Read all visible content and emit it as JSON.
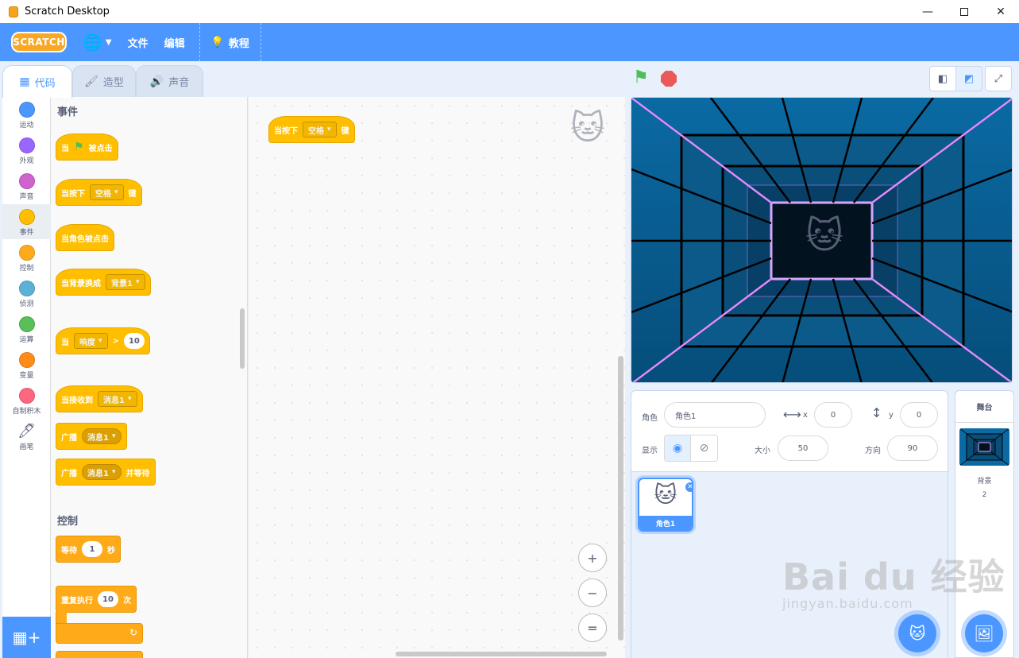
{
  "window": {
    "title": "Scratch Desktop",
    "min": "—",
    "close": "✕"
  },
  "menubar": {
    "logo": "SCRATCH",
    "file": "文件",
    "edit": "编辑",
    "tutorials": "教程"
  },
  "tabs": {
    "code": "代码",
    "costumes": "造型",
    "sounds": "声音"
  },
  "categories": [
    {
      "label": "运动",
      "color": "#4c97ff"
    },
    {
      "label": "外观",
      "color": "#9966ff"
    },
    {
      "label": "声音",
      "color": "#cf63cf"
    },
    {
      "label": "事件",
      "color": "#ffbf00"
    },
    {
      "label": "控制",
      "color": "#ffab19"
    },
    {
      "label": "侦测",
      "color": "#5cb1d6"
    },
    {
      "label": "运算",
      "color": "#59c059"
    },
    {
      "label": "变量",
      "color": "#ff8c1a"
    },
    {
      "label": "自制积木",
      "color": "#ff6680"
    },
    {
      "label": "画笔",
      "color": "#0fbd8c"
    }
  ],
  "palette": {
    "events_heading": "事件",
    "when_flag_pre": "当",
    "when_flag_post": "被点击",
    "when_key_pre": "当按下",
    "when_key_value": "空格",
    "when_key_post": "键",
    "when_sprite_clicked": "当角色被点击",
    "when_backdrop_pre": "当背景换成",
    "when_backdrop_value": "背景1",
    "when_loudness_pre": "当",
    "when_loudness_value": "响度",
    "when_loudness_op": ">",
    "when_loudness_num": "10",
    "when_receive_pre": "当接收到",
    "when_receive_value": "消息1",
    "broadcast_pre": "广播",
    "broadcast_value": "消息1",
    "broadcast_wait_pre": "广播",
    "broadcast_wait_value": "消息1",
    "broadcast_wait_post": "并等待",
    "control_heading": "控制",
    "wait_pre": "等待",
    "wait_num": "1",
    "wait_post": "秒",
    "repeat_pre": "重复执行",
    "repeat_num": "10",
    "repeat_post": "次"
  },
  "workspace": {
    "block_pre": "当按下",
    "block_value": "空格",
    "block_post": "键",
    "zoom_in": "+",
    "zoom_out": "−",
    "zoom_reset": "="
  },
  "sprite_info": {
    "sprite_label": "角色",
    "sprite_name": "角色1",
    "x_label": "x",
    "x_value": "0",
    "y_label": "y",
    "y_value": "0",
    "show_label": "显示",
    "size_label": "大小",
    "size_value": "50",
    "direction_label": "方向",
    "direction_value": "90"
  },
  "sprites": [
    {
      "name": "角色1"
    }
  ],
  "stage_panel": {
    "header": "舞台",
    "backdrops_label": "背景",
    "backdrops_count": "2"
  },
  "watermark": {
    "big": "Bai du 经验",
    "small": "jingyan.baidu.com"
  },
  "colors": {
    "accent": "#4c97ff",
    "events": "#ffbf00",
    "control": "#ffab19"
  }
}
